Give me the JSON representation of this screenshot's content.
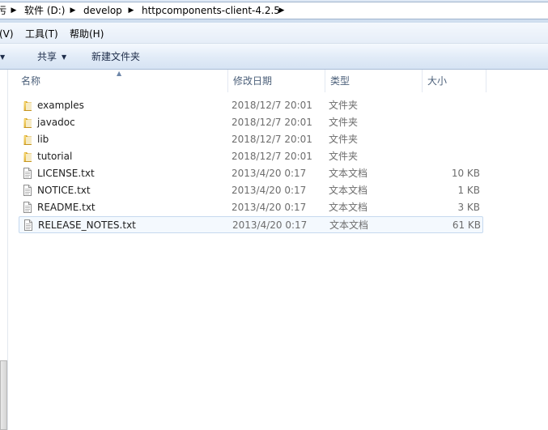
{
  "address_bar": {
    "partial_left": "污",
    "crumbs": [
      "软件 (D:)",
      "develop",
      "httpcomponents-client-4.2.5"
    ]
  },
  "menu": {
    "items": [
      "(V)",
      "工具(T)",
      "帮助(H)"
    ]
  },
  "toolbar": {
    "share_label": "共享",
    "new_folder_label": "新建文件夹"
  },
  "columns": {
    "name": "名称",
    "date": "修改日期",
    "type": "类型",
    "size": "大小"
  },
  "files": [
    {
      "name": "examples",
      "date": "2018/12/7 20:01",
      "type": "文件夹",
      "size": "",
      "icon": "folder-icon"
    },
    {
      "name": "javadoc",
      "date": "2018/12/7 20:01",
      "type": "文件夹",
      "size": "",
      "icon": "folder-icon"
    },
    {
      "name": "lib",
      "date": "2018/12/7 20:01",
      "type": "文件夹",
      "size": "",
      "icon": "folder-icon"
    },
    {
      "name": "tutorial",
      "date": "2018/12/7 20:01",
      "type": "文件夹",
      "size": "",
      "icon": "folder-icon"
    },
    {
      "name": "LICENSE.txt",
      "date": "2013/4/20 0:17",
      "type": "文本文档",
      "size": "10 KB",
      "icon": "text-file-icon"
    },
    {
      "name": "NOTICE.txt",
      "date": "2013/4/20 0:17",
      "type": "文本文档",
      "size": "1 KB",
      "icon": "text-file-icon"
    },
    {
      "name": "README.txt",
      "date": "2013/4/20 0:17",
      "type": "文本文档",
      "size": "3 KB",
      "icon": "text-file-icon"
    },
    {
      "name": "RELEASE_NOTES.txt",
      "date": "2013/4/20 0:17",
      "type": "文本文档",
      "size": "61 KB",
      "icon": "text-file-icon"
    }
  ],
  "colors": {
    "selection_bg": "#f4f9fe",
    "selection_border": "#c6d9ef",
    "header_text": "#4c607a"
  }
}
